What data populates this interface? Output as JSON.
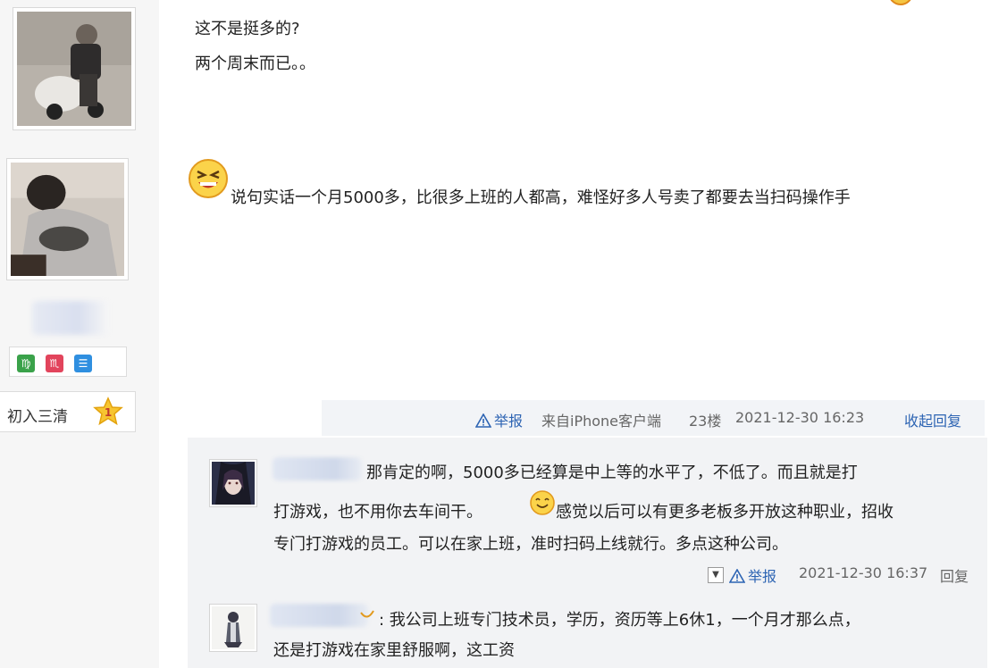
{
  "posts": [
    {
      "lines": [
        "这不是挺多的?",
        "两个周末而已。。"
      ]
    },
    {
      "text": "说句实话一个月5000多，比很多上班的人都高，难怪好多人号卖了都要去当扫码操作手"
    }
  ],
  "user_panel": {
    "rank_label": "初入三清",
    "rank_level": "1",
    "badges": [
      {
        "icon": "virgo-icon",
        "glyph": "♍",
        "color": "#3aa24a"
      },
      {
        "icon": "scorpio-icon",
        "glyph": "♏",
        "color": "#e2445c"
      },
      {
        "icon": "menu-badge-icon",
        "glyph": "☰",
        "color": "#2f8fe0"
      }
    ]
  },
  "footer": {
    "report_label": "举报",
    "source": "来自iPhone客户端",
    "floor": "23楼",
    "timestamp": "2021-12-30 16:23",
    "collapse_label": "收起回复"
  },
  "replies": [
    {
      "lines": [
        "那肯定的啊，5000多已经算是中上等的水平了，不低了。而且就是打",
        "打游戏，也不用你去车间干。",
        "感觉以后可以有更多老板多开放这种职业，招收",
        "专门打游戏的员工。可以在家上班，准时扫码上线就行。多点这种公司。"
      ],
      "report_label": "举报",
      "timestamp": "2021-12-30 16:37",
      "reply_label": "回复"
    },
    {
      "lines": [
        ": 我公司上班专门技术员，学历，资历等上6休1，一个月才那么点，",
        "还是打游戏在家里舒服啊，这工资"
      ]
    }
  ],
  "colors": {
    "link": "#2d64b3",
    "reply_bg": "#f2f3f5",
    "footer_bg": "#f2f4f7"
  }
}
